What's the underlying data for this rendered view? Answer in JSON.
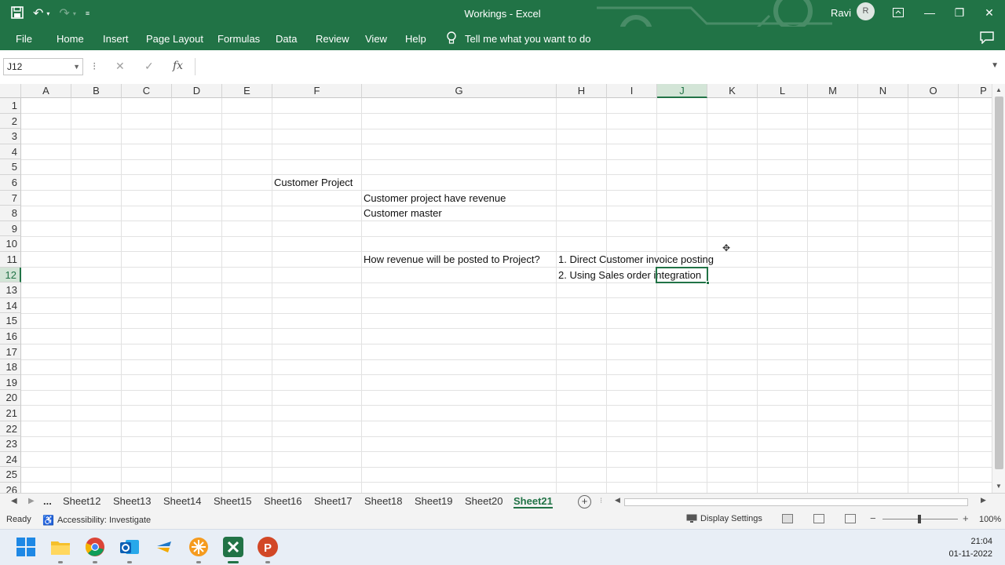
{
  "window": {
    "title": "Workings  -  Excel",
    "user_name": "Ravi",
    "avatar_initial": "R"
  },
  "ribbon": {
    "tabs": [
      "File",
      "Home",
      "Insert",
      "Page Layout",
      "Formulas",
      "Data",
      "Review",
      "View",
      "Help"
    ],
    "tell_me": "Tell me what you want to do"
  },
  "formula_bar": {
    "name_box": "J12",
    "fx": "fx",
    "value": ""
  },
  "grid": {
    "columns": [
      "A",
      "B",
      "C",
      "D",
      "E",
      "F",
      "G",
      "H",
      "I",
      "J",
      "K",
      "L",
      "M",
      "N",
      "O",
      "P"
    ],
    "selected_column": "J",
    "rows": [
      "1",
      "2",
      "3",
      "4",
      "5",
      "6",
      "7",
      "8",
      "9",
      "10",
      "11",
      "12",
      "13",
      "14",
      "15",
      "16",
      "17",
      "18",
      "19",
      "20",
      "21",
      "22",
      "23",
      "24",
      "25",
      "26"
    ],
    "selected_row": "12",
    "cells": {
      "F6": "Customer Project",
      "G7": "Customer project have revenue",
      "G8": "Customer master",
      "G11": "How revenue will be posted to Project?",
      "H11": "1. Direct Customer invoice posting",
      "H12": "2. Using Sales order integration"
    }
  },
  "sheets": {
    "ellipsis": "...",
    "tabs": [
      "Sheet12",
      "Sheet13",
      "Sheet14",
      "Sheet15",
      "Sheet16",
      "Sheet17",
      "Sheet18",
      "Sheet19",
      "Sheet20",
      "Sheet21"
    ],
    "active": "Sheet21"
  },
  "status": {
    "ready": "Ready",
    "accessibility": "Accessibility: Investigate",
    "display_settings": "Display Settings",
    "zoom": "100%"
  },
  "taskbar": {
    "time": "21:04",
    "date": "01-11-2022"
  }
}
